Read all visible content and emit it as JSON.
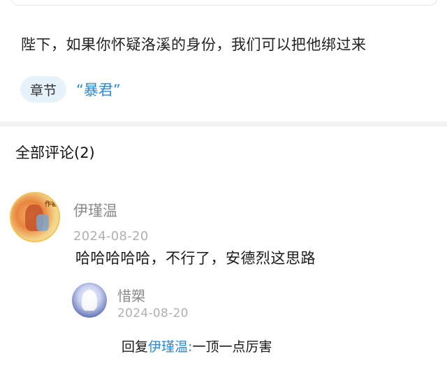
{
  "post": {
    "text": "陛下，如果你怀疑洛溪的身份，我们可以把他绑过来",
    "chapter_chip": "章节",
    "chapter_title": "“暴君”"
  },
  "comments_section": {
    "title": "全部评论(2)"
  },
  "comments": [
    {
      "username": "伊瑾温",
      "date": "2024-08-20",
      "text": "哈哈哈哈哈，不行了，安德烈这思路",
      "avatar_badge": "作者"
    }
  ],
  "reply": {
    "username": "惜槊",
    "date": "2024-08-20",
    "prefix": "回复",
    "target": "伊瑾温",
    "separator": ":",
    "text": "一顶一点厉害"
  },
  "colors": {
    "accent": "#2b8ad8",
    "chip_bg": "#e7f3fb",
    "muted": "#8a8a8a",
    "divider": "#f2f2f2"
  }
}
